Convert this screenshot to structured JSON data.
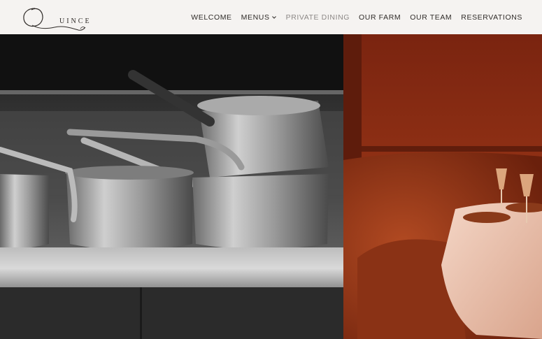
{
  "logo": {
    "text": "UINCE",
    "image": "quince-script-q-logo"
  },
  "nav": {
    "items": [
      {
        "label": "WELCOME",
        "state": "default"
      },
      {
        "label": "MENUS",
        "state": "default",
        "icon": "chevron-down-icon"
      },
      {
        "label": "PRIVATE DINING",
        "state": "active"
      },
      {
        "label": "OUR FARM",
        "state": "default"
      },
      {
        "label": "OUR TEAM",
        "state": "default"
      },
      {
        "label": "RESERVATIONS",
        "state": "default"
      }
    ]
  },
  "images": {
    "left": "black-and-white-copper-pots-on-shelf",
    "right": "red-velvet-booth-with-table-and-champagne-glasses"
  },
  "colors": {
    "header_bg": "#f5f3f1",
    "nav_text": "#2f2b28",
    "nav_active": "#8c8886"
  }
}
